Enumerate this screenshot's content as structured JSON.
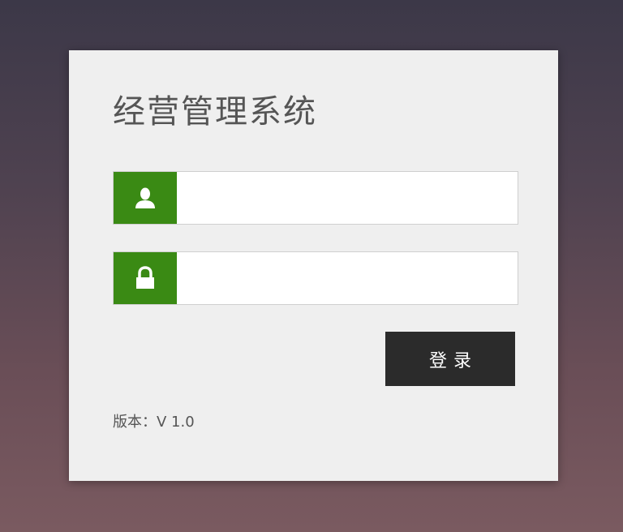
{
  "app": {
    "title": "经营管理系统",
    "accent_color": "#3a8a14"
  },
  "form": {
    "username": {
      "icon": "user-icon",
      "value": "",
      "placeholder": ""
    },
    "password": {
      "icon": "lock-icon",
      "value": "",
      "placeholder": ""
    },
    "login_label": "登录"
  },
  "footer": {
    "version_text": "版本：V 1.0"
  }
}
